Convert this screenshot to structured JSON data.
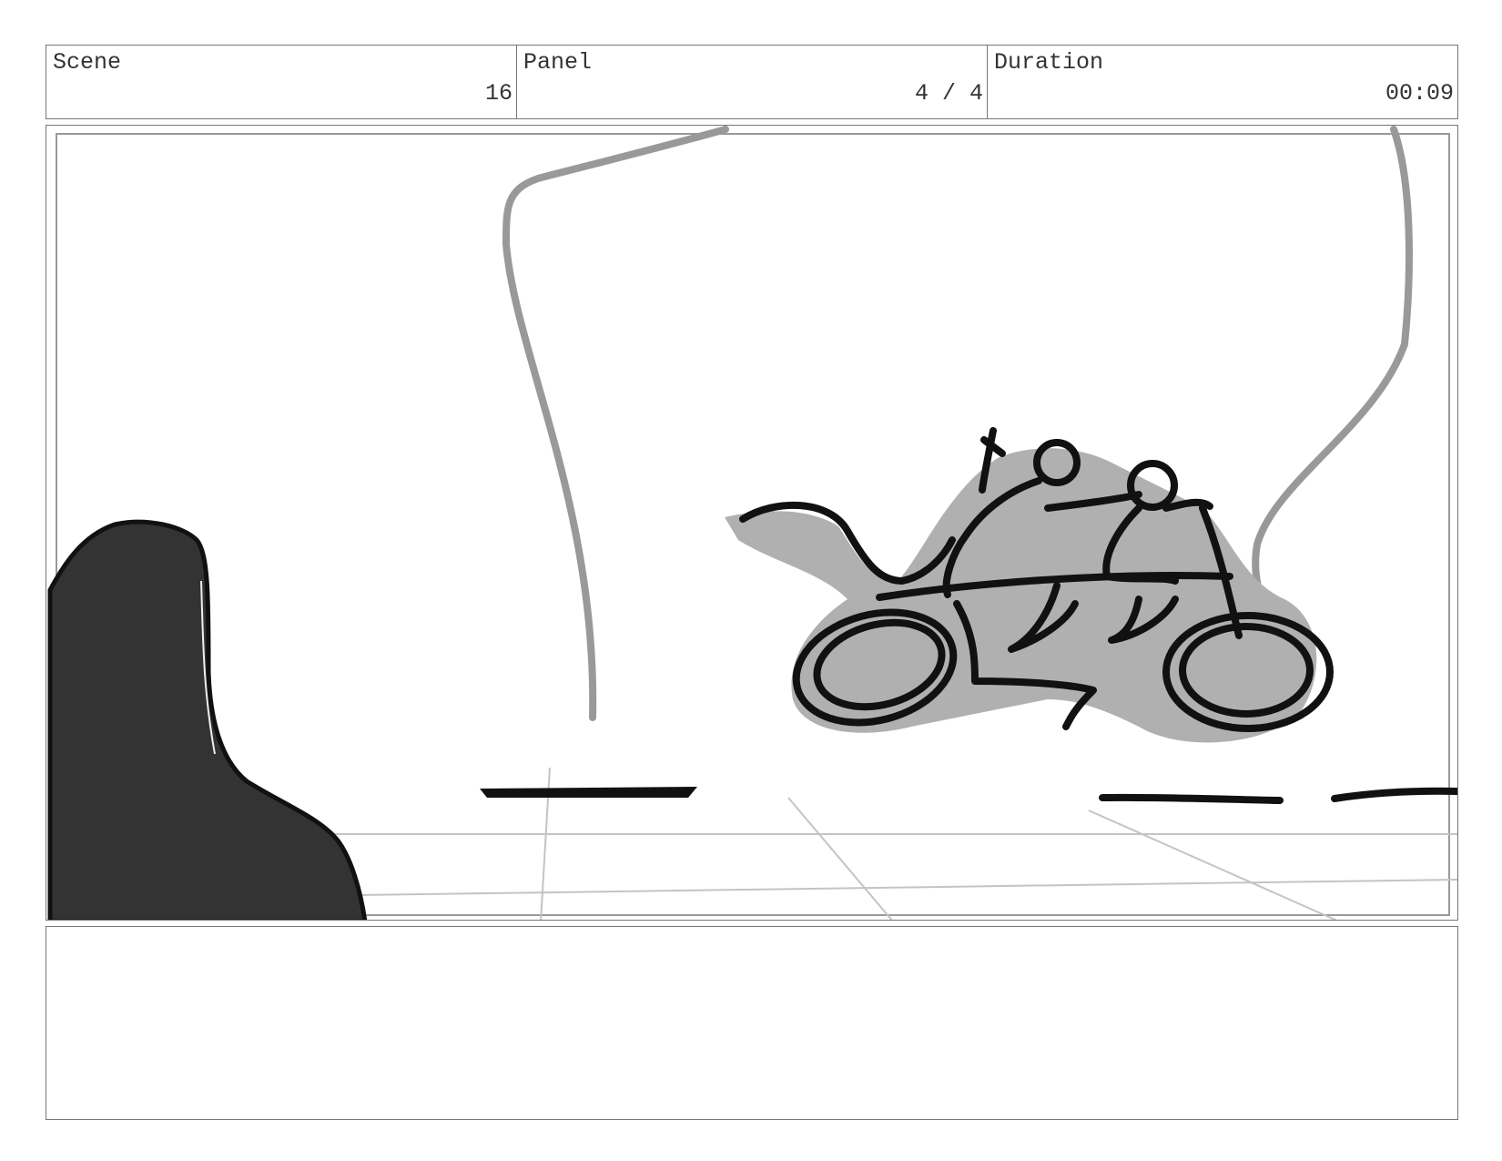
{
  "header": {
    "scene": {
      "label": "Scene",
      "value": "16"
    },
    "panel": {
      "label": "Panel",
      "value": "4 / 4"
    },
    "duration": {
      "label": "Duration",
      "value": "00:09"
    }
  },
  "frame": {
    "illustration": "storyboard sketch: two riders on a motorcycle on a road, dark rock in foreground left"
  },
  "notes": {
    "text": ""
  }
}
